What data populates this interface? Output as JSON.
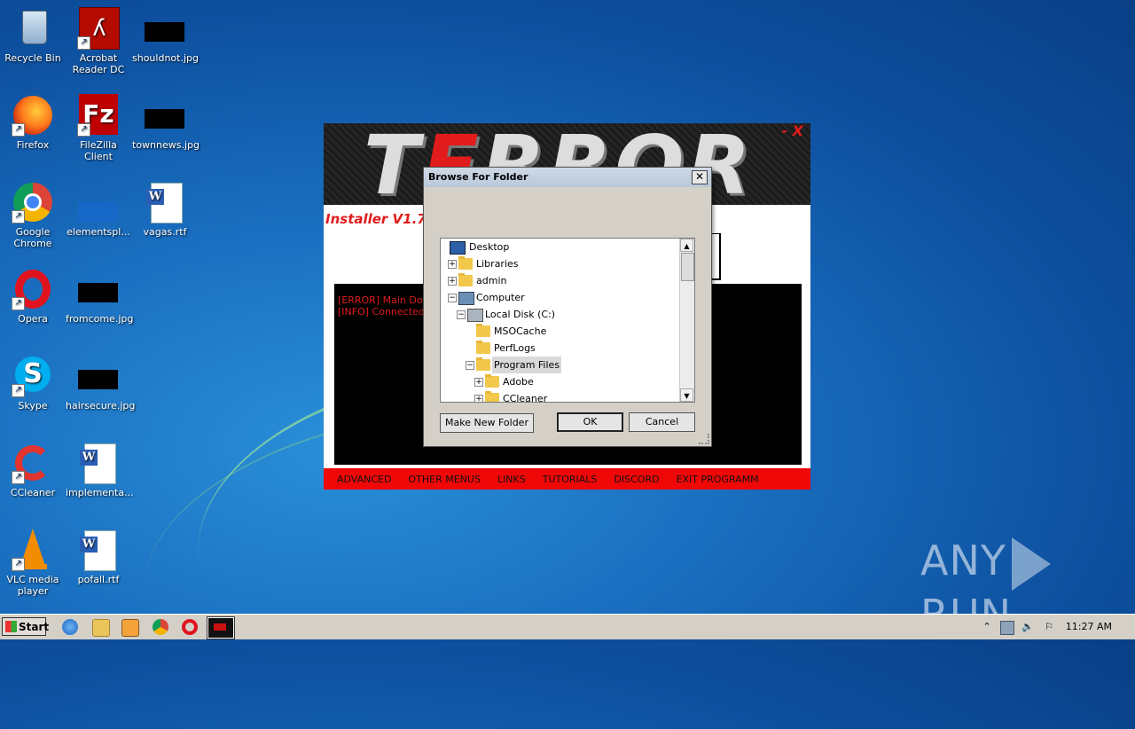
{
  "desktop": {
    "icons": [
      {
        "label": "Recycle Bin"
      },
      {
        "label": "Acrobat Reader DC"
      },
      {
        "label": "shouldnot.jpg"
      },
      {
        "label": "Firefox"
      },
      {
        "label": "FileZilla Client"
      },
      {
        "label": "townnews.jpg"
      },
      {
        "label": "Google Chrome"
      },
      {
        "label": "elementspl..."
      },
      {
        "label": "vagas.rtf"
      },
      {
        "label": "Opera"
      },
      {
        "label": "fromcome.jpg"
      },
      {
        "label": "Skype"
      },
      {
        "label": "hairsecure.jpg"
      },
      {
        "label": "CCleaner"
      },
      {
        "label": "implementa..."
      },
      {
        "label": "VLC media player"
      },
      {
        "label": "pofall.rtf"
      }
    ]
  },
  "terror": {
    "logo": "TERROR",
    "close": "- X",
    "version": "Installer V1.7",
    "log_lines": [
      "[ERROR] Main Dow",
      "[INFO] Connected to"
    ],
    "menu": [
      "ADVANCED",
      "OTHER MENUS",
      "LINKS",
      "TUTORIALS",
      "DISCORD",
      "EXIT PROGRAMM"
    ]
  },
  "dialog": {
    "title": "Browse For Folder",
    "close": "✕",
    "tree": [
      {
        "label": "Desktop"
      },
      {
        "label": "Libraries"
      },
      {
        "label": "admin"
      },
      {
        "label": "Computer"
      },
      {
        "label": "Local Disk (C:)"
      },
      {
        "label": "MSOCache"
      },
      {
        "label": "PerfLogs"
      },
      {
        "label": "Program Files"
      },
      {
        "label": "Adobe"
      },
      {
        "label": "CCleaner"
      }
    ],
    "buttons": {
      "new_folder": "Make New Folder",
      "ok": "OK",
      "cancel": "Cancel"
    }
  },
  "taskbar": {
    "start": "Start",
    "clock": "11:27 AM"
  },
  "watermark": {
    "left": "ANY",
    "right": "RUN"
  }
}
